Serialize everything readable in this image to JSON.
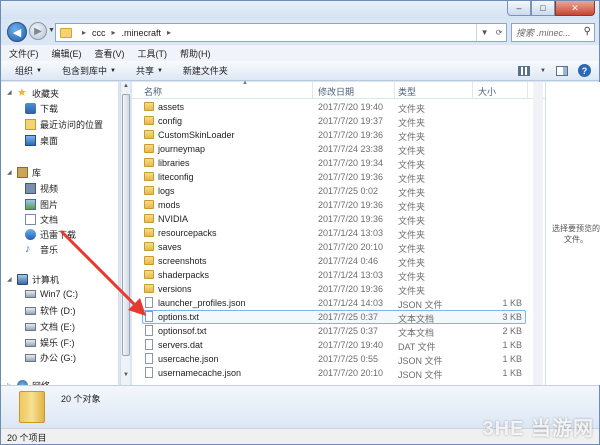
{
  "window": {
    "min_label": "–",
    "max_label": "□",
    "close_label": "✕"
  },
  "address": {
    "back_label": "◀",
    "forward_label": "▶",
    "crumbs": [
      "ccc",
      ".minecraft"
    ],
    "separator": "▸",
    "search_placeholder": "搜索 .minec...",
    "search_icon": "magnifier-icon"
  },
  "menubar": {
    "items": [
      "文件(F)",
      "编辑(E)",
      "查看(V)",
      "工具(T)",
      "帮助(H)"
    ]
  },
  "toolbar": {
    "organize": "组织",
    "include_library": "包含到库中",
    "share": "共享",
    "new_folder": "新建文件夹",
    "help": "?"
  },
  "sidebar": {
    "favorites": "收藏夹",
    "downloads": "下载",
    "recent": "最近访问的位置",
    "desktop": "桌面",
    "libraries": "库",
    "videos": "视频",
    "pictures": "图片",
    "documents": "文档",
    "xunlei": "迅雷下载",
    "music": "音乐",
    "computer": "计算机",
    "drive_c": "Win7 (C:)",
    "drive_d": "软件 (D:)",
    "drive_e": "文档 (E:)",
    "drive_f": "娱乐 (F:)",
    "drive_g": "办公 (G:)",
    "network": "网络"
  },
  "columns": {
    "name": "名称",
    "date": "修改日期",
    "type": "类型",
    "size": "大小"
  },
  "files": [
    {
      "name": "assets",
      "date": "2017/7/20 19:40",
      "type": "文件夹",
      "size": "",
      "kind": "folder"
    },
    {
      "name": "config",
      "date": "2017/7/20 19:37",
      "type": "文件夹",
      "size": "",
      "kind": "folder"
    },
    {
      "name": "CustomSkinLoader",
      "date": "2017/7/20 19:36",
      "type": "文件夹",
      "size": "",
      "kind": "folder"
    },
    {
      "name": "journeymap",
      "date": "2017/7/24 23:38",
      "type": "文件夹",
      "size": "",
      "kind": "folder"
    },
    {
      "name": "libraries",
      "date": "2017/7/20 19:34",
      "type": "文件夹",
      "size": "",
      "kind": "folder"
    },
    {
      "name": "liteconfig",
      "date": "2017/7/20 19:36",
      "type": "文件夹",
      "size": "",
      "kind": "folder"
    },
    {
      "name": "logs",
      "date": "2017/7/25 0:02",
      "type": "文件夹",
      "size": "",
      "kind": "folder"
    },
    {
      "name": "mods",
      "date": "2017/7/20 19:36",
      "type": "文件夹",
      "size": "",
      "kind": "folder"
    },
    {
      "name": "NVIDIA",
      "date": "2017/7/20 19:36",
      "type": "文件夹",
      "size": "",
      "kind": "folder"
    },
    {
      "name": "resourcepacks",
      "date": "2017/1/24 13:03",
      "type": "文件夹",
      "size": "",
      "kind": "folder"
    },
    {
      "name": "saves",
      "date": "2017/7/20 20:10",
      "type": "文件夹",
      "size": "",
      "kind": "folder"
    },
    {
      "name": "screenshots",
      "date": "2017/7/24 0:46",
      "type": "文件夹",
      "size": "",
      "kind": "folder"
    },
    {
      "name": "shaderpacks",
      "date": "2017/1/24 13:03",
      "type": "文件夹",
      "size": "",
      "kind": "folder"
    },
    {
      "name": "versions",
      "date": "2017/7/20 19:36",
      "type": "文件夹",
      "size": "",
      "kind": "folder"
    },
    {
      "name": "launcher_profiles.json",
      "date": "2017/1/24 14:03",
      "type": "JSON 文件",
      "size": "1 KB",
      "kind": "file"
    },
    {
      "name": "options.txt",
      "date": "2017/7/25 0:37",
      "type": "文本文档",
      "size": "3 KB",
      "kind": "file",
      "selected": true
    },
    {
      "name": "optionsof.txt",
      "date": "2017/7/25 0:37",
      "type": "文本文档",
      "size": "2 KB",
      "kind": "file"
    },
    {
      "name": "servers.dat",
      "date": "2017/7/20 19:40",
      "type": "DAT 文件",
      "size": "1 KB",
      "kind": "file"
    },
    {
      "name": "usercache.json",
      "date": "2017/7/25 0:55",
      "type": "JSON 文件",
      "size": "1 KB",
      "kind": "file"
    },
    {
      "name": "usernamecache.json",
      "date": "2017/7/20 20:10",
      "type": "JSON 文件",
      "size": "1 KB",
      "kind": "file"
    }
  ],
  "preview": {
    "text": "选择要预览的文件。"
  },
  "details": {
    "count": "20 个对象"
  },
  "status": {
    "text": "20 个项目"
  },
  "watermark": "3HE 当游网",
  "colors": {
    "annotation_arrow": "#e53a2e",
    "selection_border": "#7eb4ea",
    "folder": "#f4d373"
  }
}
